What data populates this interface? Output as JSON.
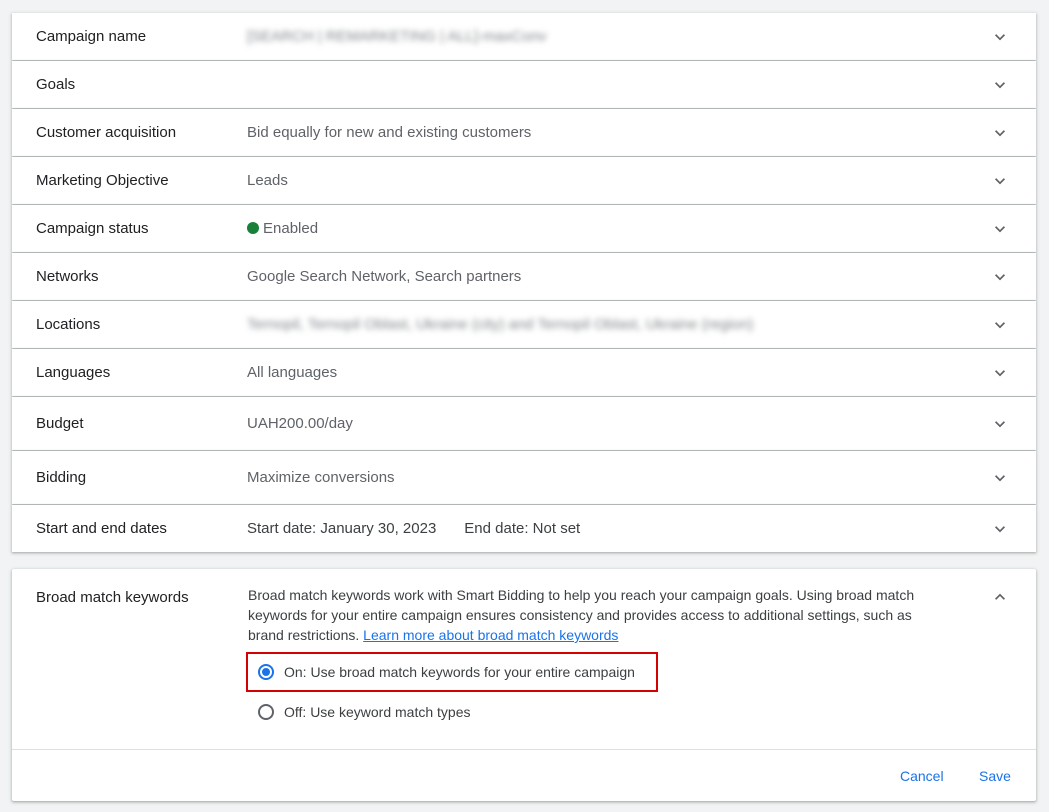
{
  "settings_rows": [
    {
      "label": "Campaign name",
      "value": "[SEARCH | REMARKETING | ALL]-maxConv"
    },
    {
      "label": "Goals",
      "value": ""
    },
    {
      "label": "Customer acquisition",
      "value": "Bid equally for new and existing customers"
    },
    {
      "label": "Marketing Objective",
      "value": "Leads"
    },
    {
      "label": "Campaign status",
      "value": "Enabled"
    },
    {
      "label": "Networks",
      "value": "Google Search Network, Search partners"
    },
    {
      "label": "Locations",
      "value": "Ternopil, Ternopil Oblast, Ukraine (city) and Ternopil Oblast, Ukraine (region)"
    },
    {
      "label": "Languages",
      "value": "All languages"
    },
    {
      "label": "Budget",
      "value": "UAH200.00/day"
    },
    {
      "label": "Bidding",
      "value": "Maximize conversions"
    },
    {
      "label": "Start and end dates",
      "start": "Start date: January 30, 2023",
      "end": "End date: Not set"
    }
  ],
  "broad_match": {
    "label": "Broad match keywords",
    "description": "Broad match keywords work with Smart Bidding to help you reach your campaign goals. Using broad match keywords for your entire campaign ensures consistency and provides access to additional settings, such as brand restrictions.",
    "learn_more": "Learn more about broad match keywords",
    "option_on": "On: Use broad match keywords for your entire campaign",
    "option_off": "Off: Use keyword match types",
    "selected": "on"
  },
  "actions": {
    "cancel": "Cancel",
    "save": "Save"
  },
  "colors": {
    "accent": "#1a73e8",
    "status_enabled": "#188038",
    "highlight": "#d50000"
  }
}
